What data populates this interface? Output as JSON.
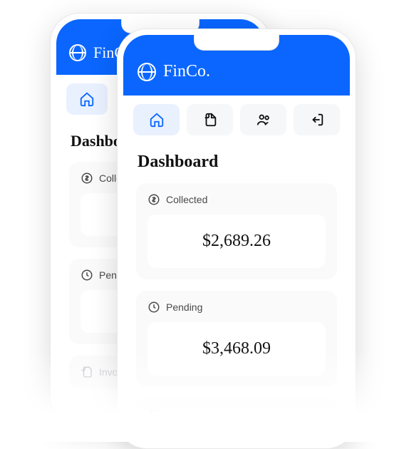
{
  "brand": "FinCo.",
  "nav": {
    "home": "home-icon",
    "documents": "documents-icon",
    "people": "people-icon",
    "logout": "logout-icon"
  },
  "page_title": "Dashboard",
  "cards": {
    "collected": {
      "label": "Collected",
      "value": "$2,689.26"
    },
    "pending": {
      "label": "Pending",
      "value": "$3,468.09"
    }
  },
  "invoices_label": "Invoices"
}
